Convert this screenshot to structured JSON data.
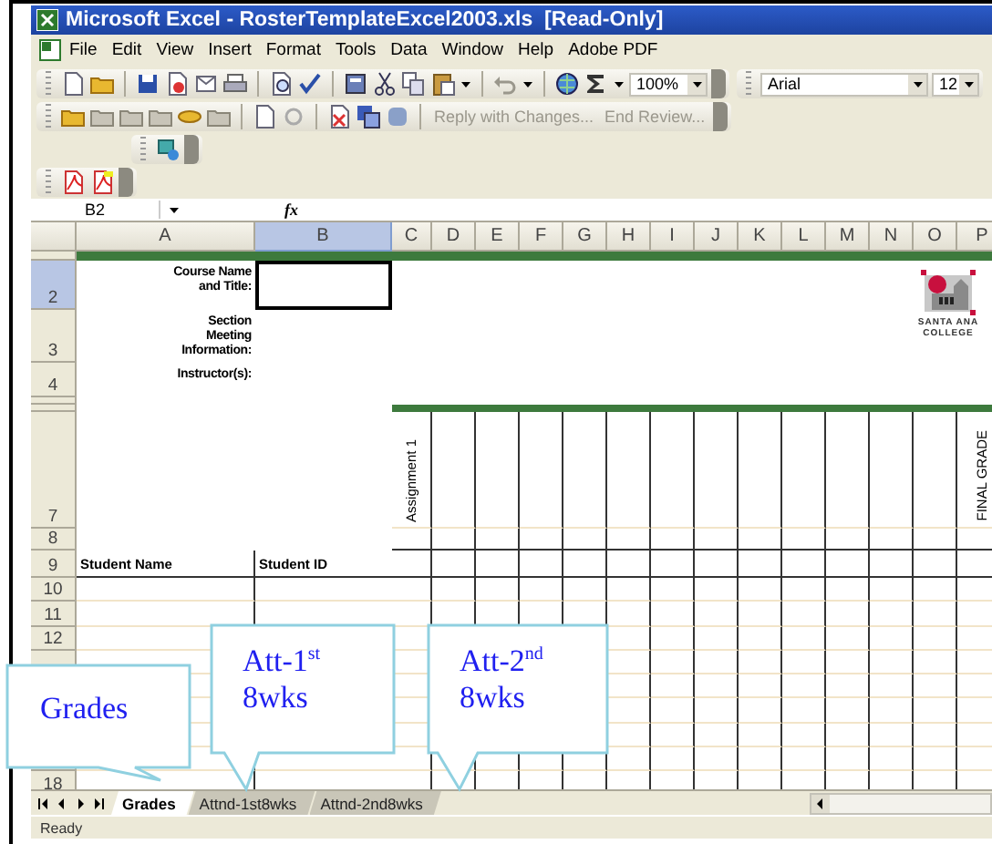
{
  "window": {
    "title": "Microsoft Excel - RosterTemplateExcel2003.xls  [Read-Only]"
  },
  "menu": [
    "File",
    "Edit",
    "View",
    "Insert",
    "Format",
    "Tools",
    "Data",
    "Window",
    "Help",
    "Adobe PDF"
  ],
  "toolbar": {
    "zoom": "100%",
    "font": "Arial",
    "font_size": "12"
  },
  "review_toolbar": {
    "reply": "Reply with Changes...",
    "end_review": "End Review..."
  },
  "formula_bar": {
    "name_box": "B2",
    "function_label": "fx"
  },
  "columns": [
    {
      "letter": "A",
      "selected": false
    },
    {
      "letter": "B",
      "selected": true
    },
    {
      "letter": "C",
      "selected": false
    },
    {
      "letter": "D",
      "selected": false
    },
    {
      "letter": "E",
      "selected": false
    },
    {
      "letter": "F",
      "selected": false
    },
    {
      "letter": "G",
      "selected": false
    },
    {
      "letter": "H",
      "selected": false
    },
    {
      "letter": "I",
      "selected": false
    },
    {
      "letter": "J",
      "selected": false
    },
    {
      "letter": "K",
      "selected": false
    },
    {
      "letter": "L",
      "selected": false
    },
    {
      "letter": "M",
      "selected": false
    },
    {
      "letter": "N",
      "selected": false
    },
    {
      "letter": "O",
      "selected": false
    },
    {
      "letter": "P",
      "selected": false
    }
  ],
  "rows": [
    {
      "selected": false
    },
    {
      "number": "2",
      "label": "Course Name and Title:",
      "selected": true
    },
    {
      "number": "3",
      "label": "Section Meeting Information:",
      "selected": false
    },
    {
      "number": "4",
      "label": "Instructor(s):",
      "selected": false
    },
    {
      "selected": false
    },
    {
      "selected": false
    },
    {
      "number": "7",
      "assignment_header": "Assignment 1",
      "final_header": "FINAL GRADE",
      "selected": false
    },
    {
      "number": "8",
      "selected": false
    },
    {
      "number": "9",
      "name_header": "Student Name",
      "id_header": "Student ID",
      "selected": false
    },
    {
      "number": "10",
      "selected": false
    },
    {
      "number": "11",
      "selected": false
    },
    {
      "number": "12",
      "selected": false
    },
    {
      "selected": false
    },
    {},
    {},
    {},
    {},
    {
      "number": "18",
      "selected": false
    }
  ],
  "logo": {
    "lines": [
      "SANTA ANA",
      "COLLEGE"
    ]
  },
  "sheet_tabs": [
    {
      "label": "Grades",
      "selected": true
    },
    {
      "label": "Attnd-1st8wks",
      "selected": false
    },
    {
      "label": "Attnd-2nd8wks",
      "selected": false
    }
  ],
  "status_bar": "Ready",
  "callouts": [
    {
      "lines": [
        "Grades"
      ]
    },
    {
      "lines": [
        "Att-1$^{st}$",
        "8wks"
      ]
    },
    {
      "lines": [
        "Att-2$^{nd}$",
        "8wks"
      ]
    }
  ]
}
